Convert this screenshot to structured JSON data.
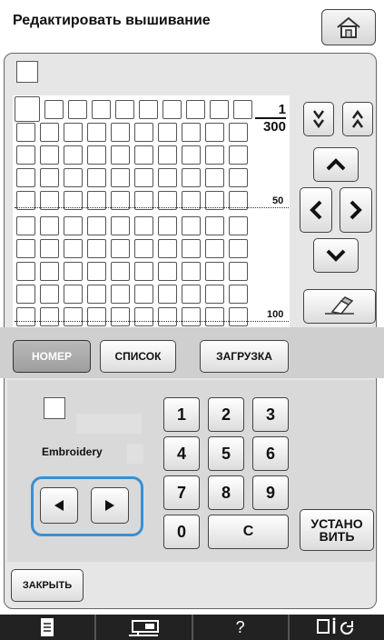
{
  "header": {
    "title": "Редактировать вышивание"
  },
  "grid": {
    "page_current": "1",
    "page_total": "300",
    "marker_mid": "50",
    "marker_end": "100"
  },
  "tabs": {
    "number": "НОМЕР",
    "list": "СПИСОК",
    "load": "ЗАГРУЗКА"
  },
  "details": {
    "embroidery_label": "Embroidery"
  },
  "keypad": {
    "k1": "1",
    "k2": "2",
    "k3": "3",
    "k4": "4",
    "k5": "5",
    "k6": "6",
    "k7": "7",
    "k8": "8",
    "k9": "9",
    "k0": "0",
    "clear": "C",
    "set": "УСТАНО\nВИТЬ"
  },
  "footer": {
    "close": "ЗАКРЫТЬ",
    "help": "?"
  }
}
